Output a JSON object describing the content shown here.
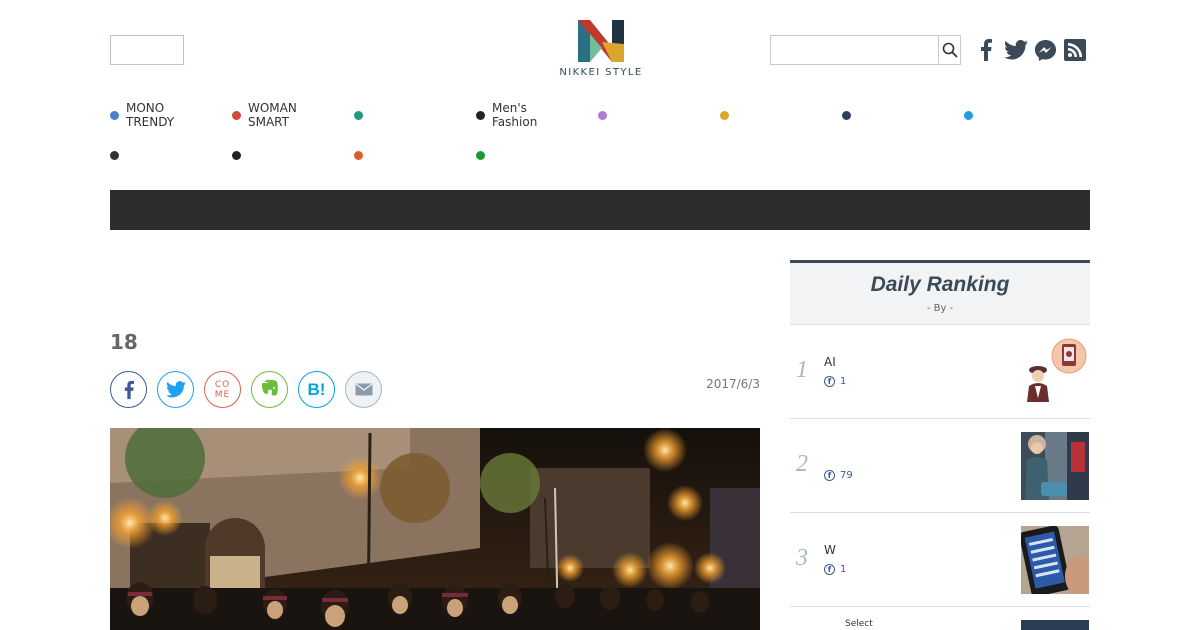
{
  "header": {
    "logo_text": "NIKKEI STYLE",
    "search_placeholder": "",
    "social_icons": [
      "facebook-icon",
      "twitter-icon",
      "messenger-icon",
      "rss-icon"
    ]
  },
  "nav": {
    "categories": [
      {
        "label": "MONO\nTRENDY",
        "color": "#4a7fc9"
      },
      {
        "label": "WOMAN\nSMART",
        "color": "#d14a3a"
      },
      {
        "label": "",
        "color": "#1f9a7a"
      },
      {
        "label": "Men's\nFashion",
        "color": "#222222"
      },
      {
        "label": "",
        "color": "#b07ad6"
      },
      {
        "label": "",
        "color": "#d9a52a"
      },
      {
        "label": "",
        "color": "#2f3d5c"
      },
      {
        "label": "",
        "color": "#1f9ee0"
      },
      {
        "label": "",
        "color": "#333333"
      },
      {
        "label": "",
        "color": "#222222"
      },
      {
        "label": "",
        "color": "#e05a30"
      },
      {
        "label": "",
        "color": "#1a9a30"
      }
    ]
  },
  "article": {
    "title": "18",
    "date": "2017/6/3",
    "share_buttons": [
      "facebook",
      "twitter",
      "come",
      "evernote",
      "hatena",
      "mail"
    ],
    "share_come_label": "COME",
    "share_hatena_label": "B!"
  },
  "ranking": {
    "title": "Daily Ranking",
    "by_line": "- By  -",
    "items": [
      {
        "rank": "1",
        "text": "AI",
        "fb_count": "1"
      },
      {
        "rank": "2",
        "text": "",
        "fb_count": "79"
      },
      {
        "rank": "3",
        "text": "W",
        "fb_count": "1"
      }
    ],
    "select_label": "Select"
  },
  "colors": {
    "dark_bar": "#2d2d2d",
    "ranking_accent": "#3c4a57",
    "facebook": "#3b5998",
    "twitter": "#1da1f2"
  }
}
